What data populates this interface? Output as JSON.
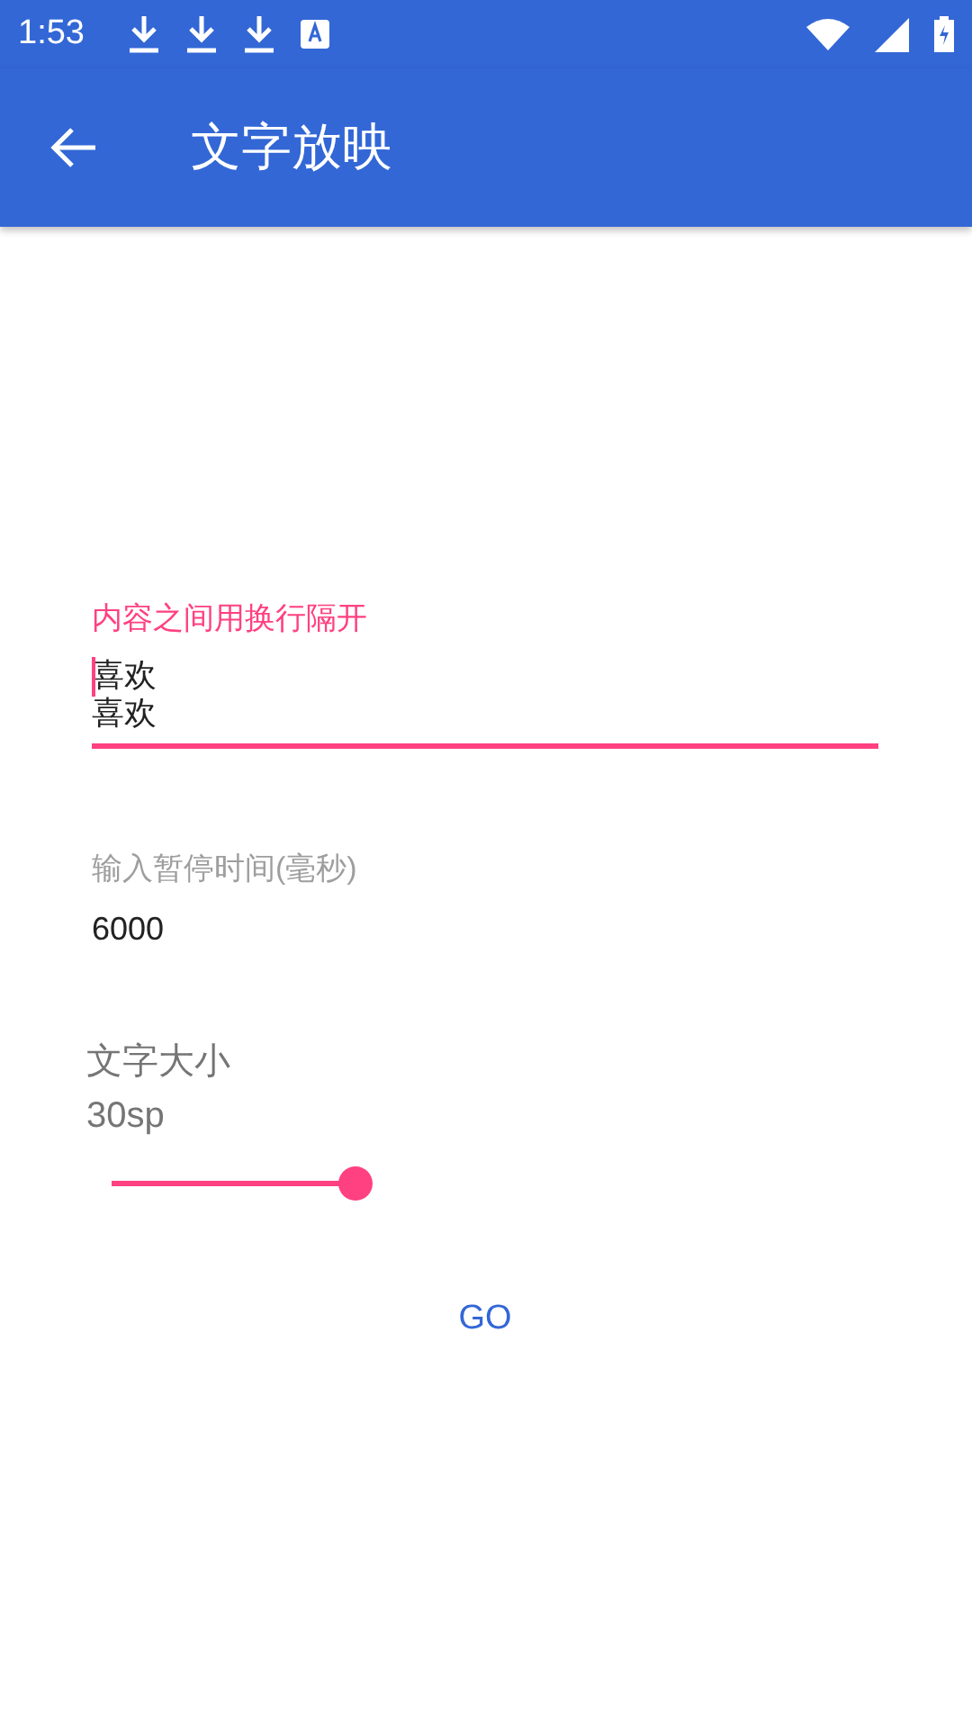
{
  "status_bar": {
    "time": "1:53"
  },
  "app_bar": {
    "title": "文字放映"
  },
  "fields": [
    {
      "label": "内容之间用换行隔开",
      "lines": [
        "喜欢",
        "喜欢"
      ],
      "focused": true
    },
    {
      "label": "输入暂停时间(毫秒)",
      "lines": [
        "6000"
      ],
      "focused": false
    }
  ],
  "text_size": {
    "label": "文字大小",
    "value": "30sp",
    "level": 1
  },
  "go_button": {
    "label": "GO"
  }
}
